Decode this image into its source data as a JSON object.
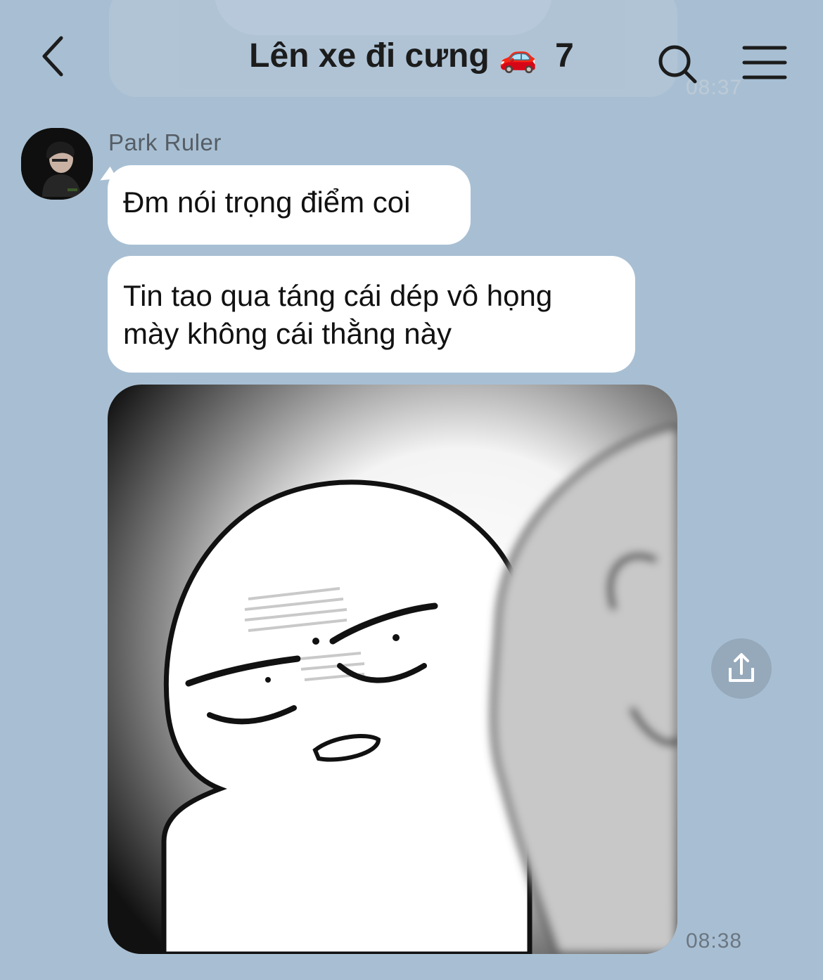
{
  "header": {
    "title": "Lên xe đi cưng",
    "title_emoji": "🚗",
    "member_count": "7"
  },
  "previous_message": {
    "time": "08:37"
  },
  "messages": [
    {
      "sender": "Park Ruler",
      "text": "Đm nói trọng điểm coi"
    },
    {
      "text_line1": "Tin tao qua táng cái dép vô họng",
      "text_line2": "mày không cái thằng này"
    },
    {
      "type": "sticker",
      "time": "08:38"
    }
  ],
  "icons": {
    "back": "chevron-left-icon",
    "search": "search-icon",
    "menu": "hamburger-menu-icon",
    "share": "share-icon"
  },
  "colors": {
    "background": "#a8bfd3",
    "bubble": "#ffffff",
    "share_button": "#95a9bb"
  }
}
